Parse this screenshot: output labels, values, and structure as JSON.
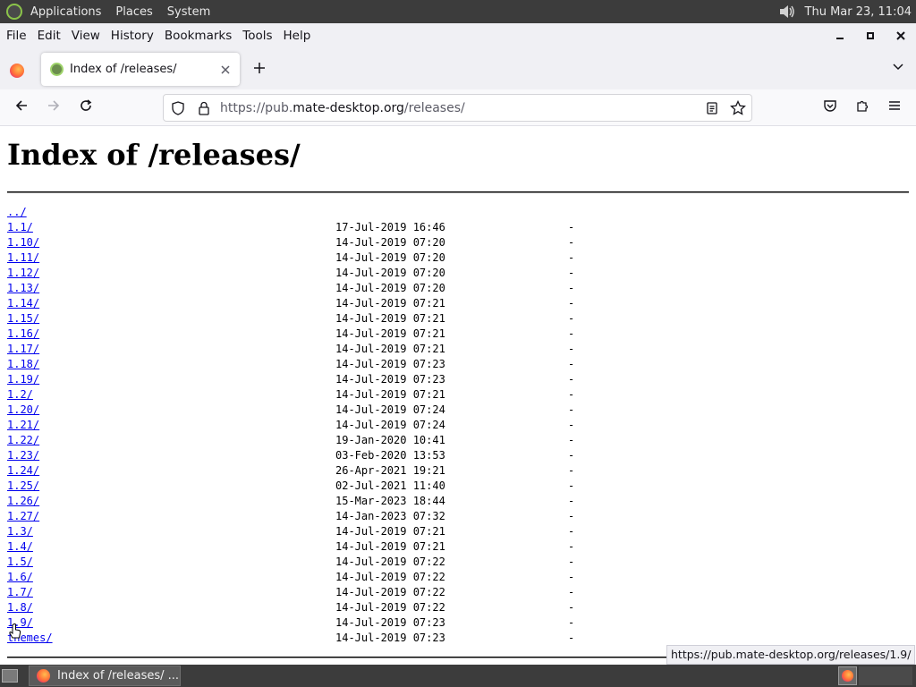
{
  "system_panel": {
    "menus": [
      "Applications",
      "Places",
      "System"
    ],
    "clock": "Thu Mar 23, 11:04"
  },
  "menubar": {
    "items": [
      {
        "label": "File"
      },
      {
        "label": "Edit"
      },
      {
        "label": "View"
      },
      {
        "label": "History"
      },
      {
        "label": "Bookmarks"
      },
      {
        "label": "Tools"
      },
      {
        "label": "Help"
      }
    ]
  },
  "tab": {
    "title": "Index of /releases/"
  },
  "urlbar": {
    "scheme": "https://pub.",
    "host": "mate-desktop.org",
    "path": "/releases/"
  },
  "page": {
    "heading": "Index of /releases/",
    "entries": [
      {
        "name": "../",
        "date": "",
        "size": ""
      },
      {
        "name": "1.1/",
        "date": "17-Jul-2019 16:46",
        "size": "-"
      },
      {
        "name": "1.10/",
        "date": "14-Jul-2019 07:20",
        "size": "-"
      },
      {
        "name": "1.11/",
        "date": "14-Jul-2019 07:20",
        "size": "-"
      },
      {
        "name": "1.12/",
        "date": "14-Jul-2019 07:20",
        "size": "-"
      },
      {
        "name": "1.13/",
        "date": "14-Jul-2019 07:20",
        "size": "-"
      },
      {
        "name": "1.14/",
        "date": "14-Jul-2019 07:21",
        "size": "-"
      },
      {
        "name": "1.15/",
        "date": "14-Jul-2019 07:21",
        "size": "-"
      },
      {
        "name": "1.16/",
        "date": "14-Jul-2019 07:21",
        "size": "-"
      },
      {
        "name": "1.17/",
        "date": "14-Jul-2019 07:21",
        "size": "-"
      },
      {
        "name": "1.18/",
        "date": "14-Jul-2019 07:23",
        "size": "-"
      },
      {
        "name": "1.19/",
        "date": "14-Jul-2019 07:23",
        "size": "-"
      },
      {
        "name": "1.2/",
        "date": "14-Jul-2019 07:21",
        "size": "-"
      },
      {
        "name": "1.20/",
        "date": "14-Jul-2019 07:24",
        "size": "-"
      },
      {
        "name": "1.21/",
        "date": "14-Jul-2019 07:24",
        "size": "-"
      },
      {
        "name": "1.22/",
        "date": "19-Jan-2020 10:41",
        "size": "-"
      },
      {
        "name": "1.23/",
        "date": "03-Feb-2020 13:53",
        "size": "-"
      },
      {
        "name": "1.24/",
        "date": "26-Apr-2021 19:21",
        "size": "-"
      },
      {
        "name": "1.25/",
        "date": "02-Jul-2021 11:40",
        "size": "-"
      },
      {
        "name": "1.26/",
        "date": "15-Mar-2023 18:44",
        "size": "-"
      },
      {
        "name": "1.27/",
        "date": "14-Jan-2023 07:32",
        "size": "-"
      },
      {
        "name": "1.3/",
        "date": "14-Jul-2019 07:21",
        "size": "-"
      },
      {
        "name": "1.4/",
        "date": "14-Jul-2019 07:21",
        "size": "-"
      },
      {
        "name": "1.5/",
        "date": "14-Jul-2019 07:22",
        "size": "-"
      },
      {
        "name": "1.6/",
        "date": "14-Jul-2019 07:22",
        "size": "-"
      },
      {
        "name": "1.7/",
        "date": "14-Jul-2019 07:22",
        "size": "-"
      },
      {
        "name": "1.8/",
        "date": "14-Jul-2019 07:22",
        "size": "-"
      },
      {
        "name": "1.9/",
        "date": "14-Jul-2019 07:23",
        "size": "-"
      },
      {
        "name": "themes/",
        "date": "14-Jul-2019 07:23",
        "size": "-"
      }
    ]
  },
  "status_tooltip": "https://pub.mate-desktop.org/releases/1.9/",
  "taskbar": {
    "task_title": "Index of /releases/ ..."
  }
}
